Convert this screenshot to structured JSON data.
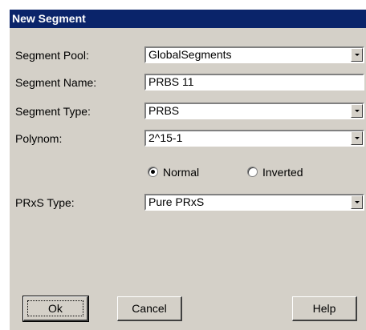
{
  "dialog": {
    "title": "New Segment"
  },
  "fields": {
    "segment_pool": {
      "label": "Segment Pool:",
      "value": "GlobalSegments"
    },
    "segment_name": {
      "label": "Segment Name:",
      "value": "PRBS 11"
    },
    "segment_type": {
      "label": "Segment Type:",
      "value": "PRBS"
    },
    "polynom": {
      "label": "Polynom:",
      "value": "2^15-1"
    },
    "prxs_type": {
      "label": "PRxS Type:",
      "value": "Pure PRxS"
    }
  },
  "polarity": {
    "options": [
      {
        "label": "Normal",
        "selected": true
      },
      {
        "label": "Inverted",
        "selected": false
      }
    ]
  },
  "buttons": {
    "ok": "Ok",
    "cancel": "Cancel",
    "help": "Help"
  },
  "colors": {
    "title_bar": "#0a246a",
    "face": "#d4d0c8",
    "field": "#ffffff"
  }
}
